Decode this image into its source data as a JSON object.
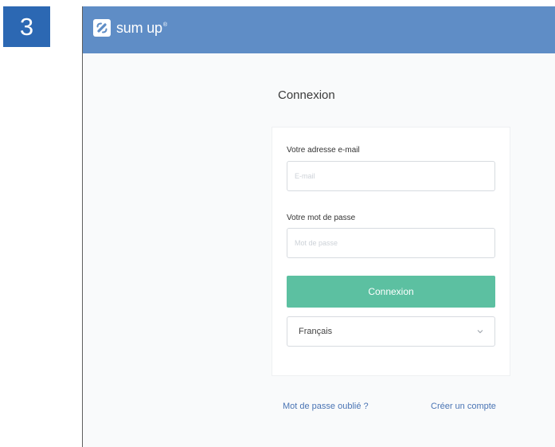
{
  "step_badge": "3",
  "brand": {
    "name": "sum up",
    "registered_mark": "®"
  },
  "page": {
    "title": "Connexion"
  },
  "form": {
    "email_label": "Votre adresse e-mail",
    "email_placeholder": "E-mail",
    "password_label": "Votre mot de passe",
    "password_placeholder": "Mot de passe",
    "submit_label": "Connexion",
    "language_value": "Français"
  },
  "links": {
    "forgot_password": "Mot de passe oublié ?",
    "create_account": "Créer un compte"
  },
  "colors": {
    "badge": "#2c68b3",
    "topbar": "#5f8dc6",
    "primary_button": "#5cc0a1",
    "link": "#4a74b4"
  },
  "icons": {
    "logo": "sumup-logo-icon",
    "dropdown": "chevron-down-icon"
  }
}
